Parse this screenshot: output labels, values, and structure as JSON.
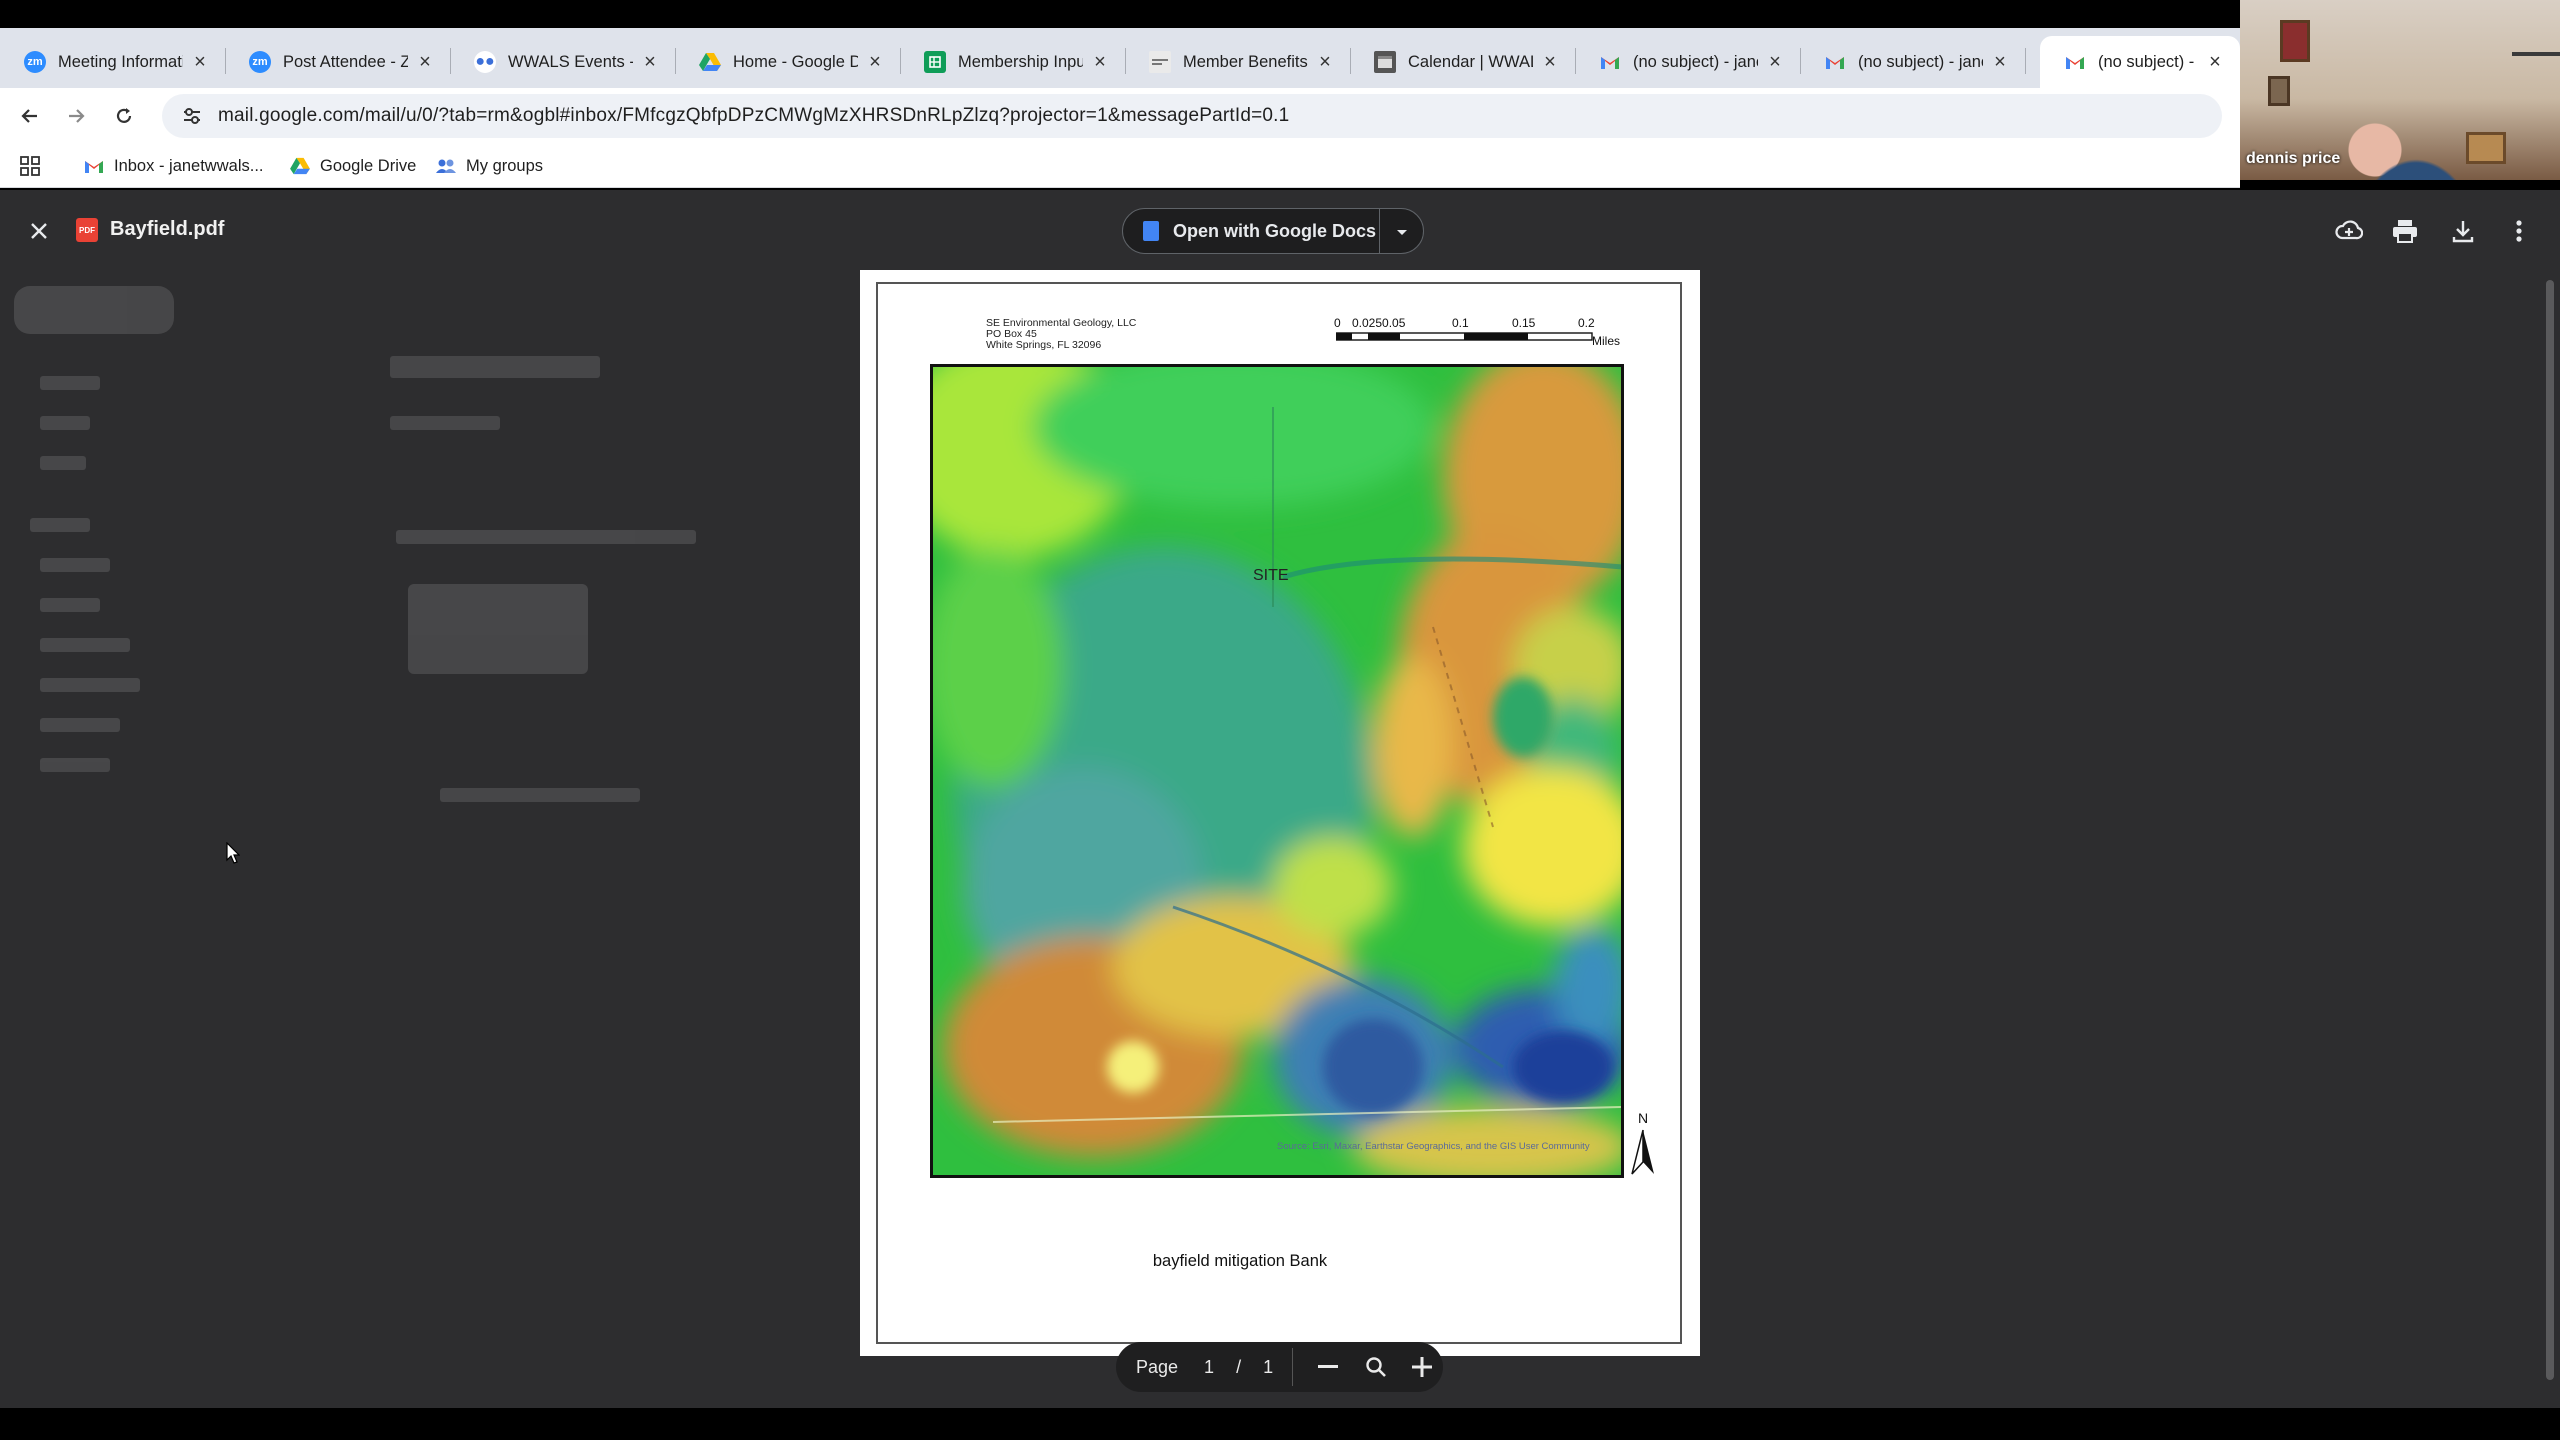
{
  "browser": {
    "tabs": [
      {
        "label": "Meeting Informati",
        "icon": "zoom-icon",
        "color": "#2d8cff",
        "active": false
      },
      {
        "label": "Post Attendee - Zo",
        "icon": "zoom-icon",
        "color": "#2d8cff",
        "active": false
      },
      {
        "label": "WWALS Events - G",
        "icon": "groups-icon",
        "color": "#3b6fd9",
        "active": false
      },
      {
        "label": "Home - Google D",
        "icon": "drive-icon",
        "color": "#1fa463",
        "active": false
      },
      {
        "label": "Membership Input",
        "icon": "sheets-icon",
        "color": "#0f9d58",
        "active": false
      },
      {
        "label": "Member Benefits",
        "icon": "page-icon",
        "color": "#777777",
        "active": false
      },
      {
        "label": "Calendar | WWALS",
        "icon": "calendar-icon",
        "color": "#444444",
        "active": false
      },
      {
        "label": "(no subject) - jane",
        "icon": "gmail-icon",
        "color": "#ea4335",
        "active": false
      },
      {
        "label": "(no subject) - jane",
        "icon": "gmail-icon",
        "color": "#ea4335",
        "active": false
      },
      {
        "label": "(no subject) - jane",
        "icon": "gmail-icon",
        "color": "#ea4335",
        "active": true
      }
    ],
    "url": "mail.google.com/mail/u/0/?tab=rm&ogbl#inbox/FMfcgzQbfpDPzCMWgMzXHRSDnRLpZlzq?projector=1&messagePartId=0.1",
    "bookmarks": [
      {
        "label": "Inbox - janetwwals...",
        "icon": "gmail-icon"
      },
      {
        "label": "Google Drive",
        "icon": "drive-icon"
      },
      {
        "label": "My groups",
        "icon": "groups-icon"
      }
    ]
  },
  "video": {
    "participant_name": "dennis price"
  },
  "viewer": {
    "file_name": "Bayfield.pdf",
    "file_badge": "PDF",
    "open_with_label": "Open with Google Docs",
    "page": {
      "company_lines": [
        "SE Environmental Geology, LLC",
        "PO Box 45",
        "White Springs, FL 32096"
      ],
      "scale_ticks": [
        "0",
        "0.0250.05",
        "0.1",
        "0.15",
        "0.2"
      ],
      "scale_unit": "Miles",
      "site_label": "SITE",
      "attribution": "Source: Esri, Maxar, Earthstar Geographics, and the GIS User Community",
      "north_label": "N",
      "caption": "bayfield mitigation Bank"
    },
    "pagination": {
      "label": "Page",
      "current": "1",
      "separator": "/",
      "total": "1"
    }
  }
}
